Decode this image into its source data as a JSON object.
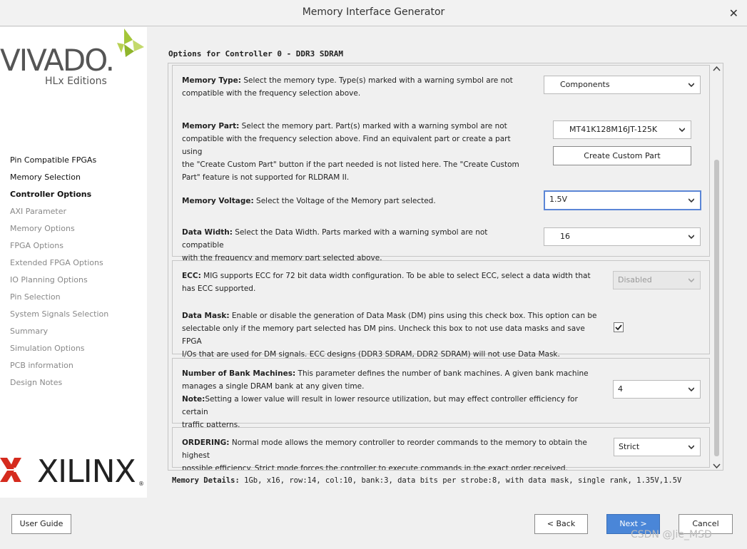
{
  "window": {
    "title": "Memory Interface Generator",
    "close_glyph": "✕"
  },
  "sidebar": {
    "logo_vivado": "VIVADO.",
    "logo_edition": "HLx Editions",
    "items": [
      {
        "label": "Pin Compatible FPGAs",
        "state": "done"
      },
      {
        "label": "Memory Selection",
        "state": "done"
      },
      {
        "label": "Controller Options",
        "state": "current"
      },
      {
        "label": "AXI Parameter",
        "state": "pending"
      },
      {
        "label": "Memory Options",
        "state": "pending"
      },
      {
        "label": "FPGA Options",
        "state": "pending"
      },
      {
        "label": "Extended FPGA Options",
        "state": "pending"
      },
      {
        "label": "IO Planning Options",
        "state": "pending"
      },
      {
        "label": "Pin Selection",
        "state": "pending"
      },
      {
        "label": "System Signals Selection",
        "state": "pending"
      },
      {
        "label": "Summary",
        "state": "pending"
      },
      {
        "label": "Simulation Options",
        "state": "pending"
      },
      {
        "label": "PCB information",
        "state": "pending"
      },
      {
        "label": "Design Notes",
        "state": "pending"
      }
    ],
    "logo_xilinx": "XILINX",
    "logo_xilinx_reg": "®"
  },
  "main": {
    "heading": "Options for Controller 0 - DDR3 SDRAM",
    "memory_type": {
      "label": "Memory Type:",
      "desc_1": " Select the memory type. Type(s) marked with a warning symbol are not",
      "desc_2": "compatible with the frequency selection above.",
      "value": "Components"
    },
    "memory_part": {
      "label": "Memory Part:",
      "desc_1": " Select the memory part. Part(s) marked with a warning symbol are not",
      "desc_2": "compatible with the frequency selection above. Find an equivalent part or create a part using",
      "desc_3": "the \"Create Custom Part\" button if the part needed is not listed here. The \"Create Custom",
      "desc_4": "Part\" feature is not supported for RLDRAM II.",
      "value": "MT41K128M16JT-125K",
      "button": "Create Custom Part"
    },
    "memory_voltage": {
      "label": "Memory Voltage:",
      "desc_1": " Select the Voltage of the Memory part selected.",
      "value": "1.5V"
    },
    "data_width": {
      "label": "Data Width:",
      "desc_1": " Select the Data Width. Parts marked with a warning symbol are not compatible",
      "desc_2": "with the frequency and memory part selected above.",
      "value": "16"
    },
    "ecc": {
      "label": "ECC:",
      "desc_1": " MIG supports ECC for 72 bit data width configuration. To be able to select ECC, select a data width that",
      "desc_2": "has ECC supported.",
      "value": "Disabled"
    },
    "data_mask": {
      "label": "Data Mask:",
      "desc_1": " Enable or disable the generation of Data Mask (DM) pins using this check box. This option can be",
      "desc_2": "selectable only if the memory part selected has DM pins. Uncheck this box to not use data masks and save FPGA",
      "desc_3": "I/Os that are used for DM signals. ECC designs (DDR3 SDRAM, DDR2 SDRAM) will not use Data Mask.",
      "checked": true
    },
    "bank_machines": {
      "label": "Number of Bank Machines:",
      "desc_1": " This parameter defines the number of bank machines. A given bank machine",
      "desc_2": "manages a single DRAM bank at any given time.",
      "note_label": "Note:",
      "note": "Setting a lower value will result in lower resource utilization, but may effect controller efficiency for certain",
      "note_2": "traffic patterns.",
      "value": "4"
    },
    "ordering": {
      "label": "ORDERING:",
      "desc_1": " Normal mode allows the memory controller to reorder commands to the memory to obtain the highest",
      "desc_2": "possible efficiency. Strict mode forces the controller to execute commands in the exact order received.",
      "value": "Strict"
    },
    "details_label": "Memory Details:",
    "details_value": " 1Gb, x16, row:14, col:10, bank:3, data bits per strobe:8, with data mask, single rank, 1.35V,1.5V"
  },
  "footer": {
    "user_guide": "User Guide",
    "back": "< Back",
    "next": "Next >",
    "cancel": "Cancel"
  },
  "watermark": "CSDN @Jie_MSD",
  "colors": {
    "accent": "#4a86d8",
    "focus": "#5b86d6",
    "vivado_green": "#a4c639",
    "xilinx_red": "#d52b1e"
  }
}
